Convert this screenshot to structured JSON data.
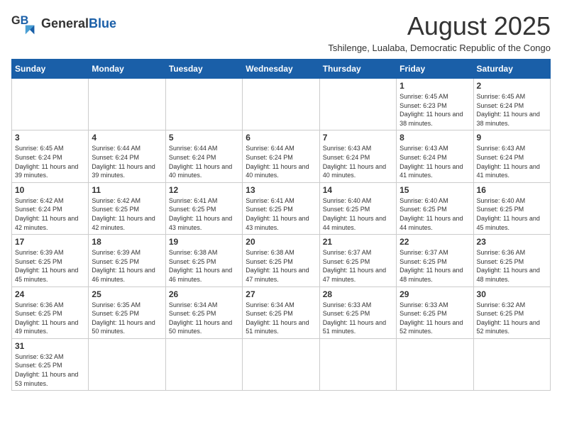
{
  "logo": {
    "line1": "General",
    "line2": "Blue"
  },
  "title": "August 2025",
  "subtitle": "Tshilenge, Lualaba, Democratic Republic of the Congo",
  "days_of_week": [
    "Sunday",
    "Monday",
    "Tuesday",
    "Wednesday",
    "Thursday",
    "Friday",
    "Saturday"
  ],
  "weeks": [
    [
      {
        "day": "",
        "info": ""
      },
      {
        "day": "",
        "info": ""
      },
      {
        "day": "",
        "info": ""
      },
      {
        "day": "",
        "info": ""
      },
      {
        "day": "",
        "info": ""
      },
      {
        "day": "1",
        "info": "Sunrise: 6:45 AM\nSunset: 6:23 PM\nDaylight: 11 hours and 38 minutes."
      },
      {
        "day": "2",
        "info": "Sunrise: 6:45 AM\nSunset: 6:24 PM\nDaylight: 11 hours and 38 minutes."
      }
    ],
    [
      {
        "day": "3",
        "info": "Sunrise: 6:45 AM\nSunset: 6:24 PM\nDaylight: 11 hours and 39 minutes."
      },
      {
        "day": "4",
        "info": "Sunrise: 6:44 AM\nSunset: 6:24 PM\nDaylight: 11 hours and 39 minutes."
      },
      {
        "day": "5",
        "info": "Sunrise: 6:44 AM\nSunset: 6:24 PM\nDaylight: 11 hours and 40 minutes."
      },
      {
        "day": "6",
        "info": "Sunrise: 6:44 AM\nSunset: 6:24 PM\nDaylight: 11 hours and 40 minutes."
      },
      {
        "day": "7",
        "info": "Sunrise: 6:43 AM\nSunset: 6:24 PM\nDaylight: 11 hours and 40 minutes."
      },
      {
        "day": "8",
        "info": "Sunrise: 6:43 AM\nSunset: 6:24 PM\nDaylight: 11 hours and 41 minutes."
      },
      {
        "day": "9",
        "info": "Sunrise: 6:43 AM\nSunset: 6:24 PM\nDaylight: 11 hours and 41 minutes."
      }
    ],
    [
      {
        "day": "10",
        "info": "Sunrise: 6:42 AM\nSunset: 6:24 PM\nDaylight: 11 hours and 42 minutes."
      },
      {
        "day": "11",
        "info": "Sunrise: 6:42 AM\nSunset: 6:25 PM\nDaylight: 11 hours and 42 minutes."
      },
      {
        "day": "12",
        "info": "Sunrise: 6:41 AM\nSunset: 6:25 PM\nDaylight: 11 hours and 43 minutes."
      },
      {
        "day": "13",
        "info": "Sunrise: 6:41 AM\nSunset: 6:25 PM\nDaylight: 11 hours and 43 minutes."
      },
      {
        "day": "14",
        "info": "Sunrise: 6:40 AM\nSunset: 6:25 PM\nDaylight: 11 hours and 44 minutes."
      },
      {
        "day": "15",
        "info": "Sunrise: 6:40 AM\nSunset: 6:25 PM\nDaylight: 11 hours and 44 minutes."
      },
      {
        "day": "16",
        "info": "Sunrise: 6:40 AM\nSunset: 6:25 PM\nDaylight: 11 hours and 45 minutes."
      }
    ],
    [
      {
        "day": "17",
        "info": "Sunrise: 6:39 AM\nSunset: 6:25 PM\nDaylight: 11 hours and 45 minutes."
      },
      {
        "day": "18",
        "info": "Sunrise: 6:39 AM\nSunset: 6:25 PM\nDaylight: 11 hours and 46 minutes."
      },
      {
        "day": "19",
        "info": "Sunrise: 6:38 AM\nSunset: 6:25 PM\nDaylight: 11 hours and 46 minutes."
      },
      {
        "day": "20",
        "info": "Sunrise: 6:38 AM\nSunset: 6:25 PM\nDaylight: 11 hours and 47 minutes."
      },
      {
        "day": "21",
        "info": "Sunrise: 6:37 AM\nSunset: 6:25 PM\nDaylight: 11 hours and 47 minutes."
      },
      {
        "day": "22",
        "info": "Sunrise: 6:37 AM\nSunset: 6:25 PM\nDaylight: 11 hours and 48 minutes."
      },
      {
        "day": "23",
        "info": "Sunrise: 6:36 AM\nSunset: 6:25 PM\nDaylight: 11 hours and 48 minutes."
      }
    ],
    [
      {
        "day": "24",
        "info": "Sunrise: 6:36 AM\nSunset: 6:25 PM\nDaylight: 11 hours and 49 minutes."
      },
      {
        "day": "25",
        "info": "Sunrise: 6:35 AM\nSunset: 6:25 PM\nDaylight: 11 hours and 50 minutes."
      },
      {
        "day": "26",
        "info": "Sunrise: 6:34 AM\nSunset: 6:25 PM\nDaylight: 11 hours and 50 minutes."
      },
      {
        "day": "27",
        "info": "Sunrise: 6:34 AM\nSunset: 6:25 PM\nDaylight: 11 hours and 51 minutes."
      },
      {
        "day": "28",
        "info": "Sunrise: 6:33 AM\nSunset: 6:25 PM\nDaylight: 11 hours and 51 minutes."
      },
      {
        "day": "29",
        "info": "Sunrise: 6:33 AM\nSunset: 6:25 PM\nDaylight: 11 hours and 52 minutes."
      },
      {
        "day": "30",
        "info": "Sunrise: 6:32 AM\nSunset: 6:25 PM\nDaylight: 11 hours and 52 minutes."
      }
    ],
    [
      {
        "day": "31",
        "info": "Sunrise: 6:32 AM\nSunset: 6:25 PM\nDaylight: 11 hours and 53 minutes."
      },
      {
        "day": "",
        "info": ""
      },
      {
        "day": "",
        "info": ""
      },
      {
        "day": "",
        "info": ""
      },
      {
        "day": "",
        "info": ""
      },
      {
        "day": "",
        "info": ""
      },
      {
        "day": "",
        "info": ""
      }
    ]
  ]
}
